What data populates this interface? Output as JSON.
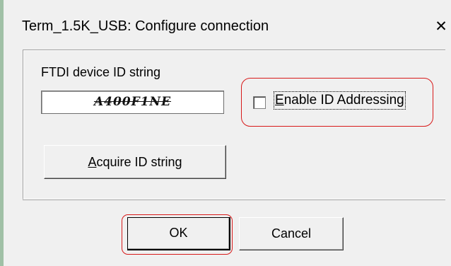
{
  "window": {
    "title": "Term_1.5K_USB: Configure connection",
    "close_glyph": "✕"
  },
  "group": {
    "label": "FTDI device ID string",
    "id_value": "A400F1NE"
  },
  "enable_id_addressing": {
    "checked": false,
    "label_mnemonic": "E",
    "label_rest": "nable ID Addressing"
  },
  "acquire_button": {
    "label_mnemonic": "A",
    "label_rest": "cquire ID string"
  },
  "ok_button": {
    "label": "OK"
  },
  "cancel_button": {
    "label": "Cancel"
  },
  "annotation": {
    "highlight_color": "#d81a1a"
  }
}
